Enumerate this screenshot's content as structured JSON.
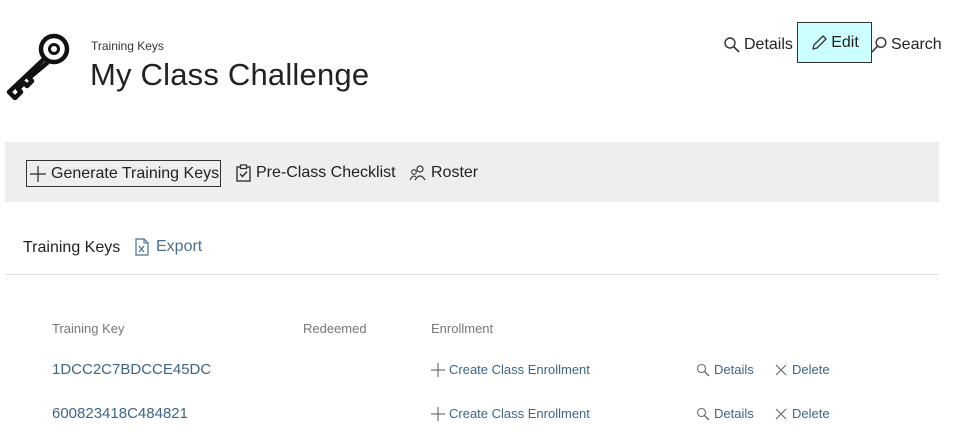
{
  "header": {
    "subtitle": "Training Keys",
    "title": "My Class Challenge",
    "logo_icon": "key-icon"
  },
  "top_actions": {
    "details": "Details",
    "edit": "Edit",
    "search": "Search",
    "edit_highlight_color": "#ccffff"
  },
  "toolbar": {
    "generate": "Generate Training Keys",
    "checklist": "Pre-Class Checklist",
    "roster": "Roster"
  },
  "section": {
    "title": "Training Keys",
    "export": "Export"
  },
  "table": {
    "columns": [
      "Training Key",
      "Redeemed",
      "Enrollment"
    ],
    "rows": [
      {
        "key": "1DCC2C7BDCCE45DC",
        "redeemed": "",
        "enrollment": "Create Class Enrollment",
        "details": "Details",
        "delete": "Delete"
      },
      {
        "key": "600823418C484821",
        "redeemed": "",
        "enrollment": "Create Class Enrollment",
        "details": "Details",
        "delete": "Delete"
      }
    ]
  },
  "colors": {
    "link": "#3d6587",
    "toolbar_bg": "#eeeeee"
  }
}
